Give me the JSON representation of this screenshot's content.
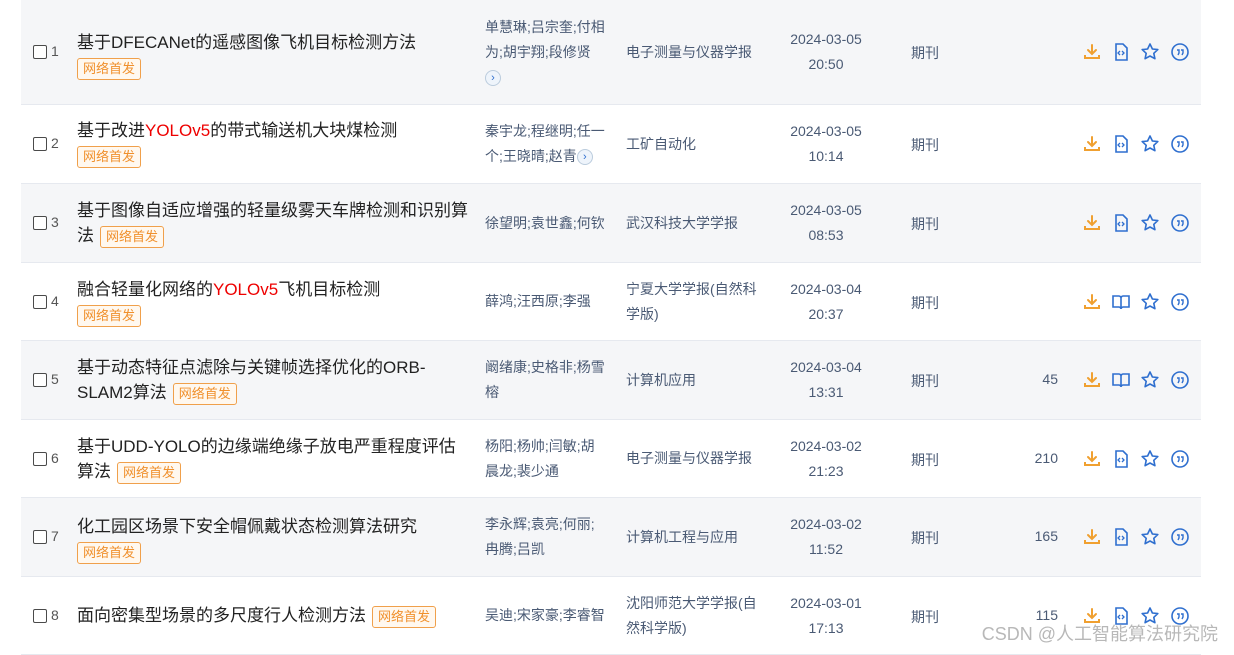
{
  "results": [
    {
      "seq": "1",
      "title_parts": [
        {
          "t": "基于DFECANet的遥感图像飞机目标检测方法",
          "hl": false
        }
      ],
      "badge": "网络首发",
      "authors_lines": [
        "单慧琳;吕宗奎;付相",
        "为;胡宇翔;段修贤"
      ],
      "has_more": true,
      "source_lines": [
        "电子测量与仪器学报"
      ],
      "date": "2024-03-05",
      "time": "20:50",
      "db": "期刊",
      "cites": "",
      "read_icon": "html-icon"
    },
    {
      "seq": "2",
      "title_parts": [
        {
          "t": "基于改进",
          "hl": false
        },
        {
          "t": "YOLOv5",
          "hl": true
        },
        {
          "t": "的带式输送机大块煤检测",
          "hl": false
        }
      ],
      "badge": "网络首发",
      "authors_lines": [
        "秦宇龙;程继明;任一",
        "个;王晓晴;赵青"
      ],
      "has_more": true,
      "source_lines": [
        "工矿自动化"
      ],
      "date": "2024-03-05",
      "time": "10:14",
      "db": "期刊",
      "cites": "",
      "read_icon": "html-icon"
    },
    {
      "seq": "3",
      "title_parts": [
        {
          "t": "基于图像自适应增强的轻量级雾天车牌检测和识别算法",
          "hl": false
        }
      ],
      "badge": "网络首发",
      "authors_lines": [
        "徐望明;袁世鑫;何钦"
      ],
      "has_more": false,
      "source_lines": [
        "武汉科技大学学报"
      ],
      "date": "2024-03-05",
      "time": "08:53",
      "db": "期刊",
      "cites": "",
      "read_icon": "html-icon"
    },
    {
      "seq": "4",
      "title_parts": [
        {
          "t": "融合轻量化网络的",
          "hl": false
        },
        {
          "t": "YOLOv5",
          "hl": true
        },
        {
          "t": "飞机目标检测",
          "hl": false
        }
      ],
      "badge": "网络首发",
      "authors_lines": [
        "薛鸿;汪西原;李强"
      ],
      "has_more": false,
      "source_lines": [
        "宁夏大学学报(自然科",
        "学版)"
      ],
      "date": "2024-03-04",
      "time": "20:37",
      "db": "期刊",
      "cites": "",
      "read_icon": "book-icon"
    },
    {
      "seq": "5",
      "title_parts": [
        {
          "t": "基于动态特征点滤除与关键帧选择优化的ORB-SLAM2算法",
          "hl": false
        }
      ],
      "badge": "网络首发",
      "authors_lines": [
        "阚绪康;史格非;杨雪",
        "榕"
      ],
      "has_more": false,
      "source_lines": [
        "计算机应用"
      ],
      "date": "2024-03-04",
      "time": "13:31",
      "db": "期刊",
      "cites": "45",
      "read_icon": "book-icon"
    },
    {
      "seq": "6",
      "title_parts": [
        {
          "t": "基于UDD-YOLO的边缘端绝缘子放电严重程度评估算法",
          "hl": false
        }
      ],
      "badge": "网络首发",
      "authors_lines": [
        "杨阳;杨帅;闫敏;胡",
        "晨龙;裴少通"
      ],
      "has_more": false,
      "source_lines": [
        "电子测量与仪器学报"
      ],
      "date": "2024-03-02",
      "time": "21:23",
      "db": "期刊",
      "cites": "210",
      "read_icon": "html-icon"
    },
    {
      "seq": "7",
      "title_parts": [
        {
          "t": "化工园区场景下安全帽佩戴状态检测算法研究",
          "hl": false
        }
      ],
      "badge": "网络首发",
      "authors_lines": [
        "李永辉;袁亮;何丽;",
        "冉腾;吕凯"
      ],
      "has_more": false,
      "source_lines": [
        "计算机工程与应用"
      ],
      "date": "2024-03-02",
      "time": "11:52",
      "db": "期刊",
      "cites": "165",
      "read_icon": "html-icon"
    },
    {
      "seq": "8",
      "title_parts": [
        {
          "t": "面向密集型场景的多尺度行人检测方法",
          "hl": false
        }
      ],
      "badge": "网络首发",
      "authors_lines": [
        "吴迪;宋家豪;李睿智"
      ],
      "has_more": false,
      "source_lines": [
        "沈阳师范大学学报(自",
        "然科学版)"
      ],
      "date": "2024-03-01",
      "time": "17:13",
      "db": "期刊",
      "cites": "115",
      "read_icon": "html-icon"
    }
  ],
  "watermark": "CSDN @人工智能算法研究院",
  "colors": {
    "row_alt": "#f5f6f8",
    "accent_orange": "#f0a030",
    "accent_blue": "#2f6fcf",
    "highlight_red": "#ee0000"
  }
}
